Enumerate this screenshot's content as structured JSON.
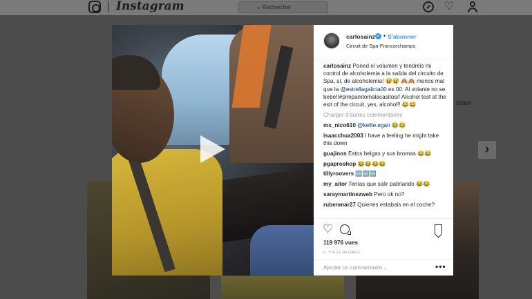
{
  "header": {
    "brand": "Instagram",
    "search_placeholder": "Rechercher",
    "nav_icons": [
      "instagram-logo-icon",
      "compass-icon",
      "heart-icon",
      "person-icon"
    ]
  },
  "background": {
    "partial_text": "team",
    "next_arrow": "›"
  },
  "post": {
    "username": "carlosainz",
    "verified_mark": "✔",
    "separator": "•",
    "follow_label": "S'abonner",
    "location": "Circuit de Spa-Francorchamps",
    "caption_user": "carlosainz",
    "caption_text_1": " Poned el volumen y tendréis mi control de alcoholemia a la salida del circuito de Spa, sí, de alcoholemia! 😅😅 🙈🙈 menos mal que la ",
    "caption_mention": "@estrellagalicia00",
    "caption_text_2": " es 00. Al volante no se bebe!!#pimpamtomalacasitos// Alcohol test at the exit of the circuit, yes, alcohol!! 😂😂",
    "load_more": "Charger d'autres commentaires",
    "comments": [
      {
        "user": "mx_nico610",
        "mention": "@kellie.egan",
        "text": " 😂😂"
      },
      {
        "user": "isaacchua2003",
        "mention": "",
        "text": " I have a feeling he might take this down"
      },
      {
        "user": "guajinos",
        "mention": "",
        "text": " Estos belgas y sus bromas 😂😂"
      },
      {
        "user": "pgaproshop",
        "mention": "",
        "text": " 😂😂😂😂"
      },
      {
        "user": "tillyroovers",
        "mention": "",
        "text": " 🆒🆒🆒"
      },
      {
        "user": "my_aitor",
        "mention": "",
        "text": " Tenías que salir patinando 😂😂"
      },
      {
        "user": "saraymartinezweb",
        "mention": "",
        "text": " Pero ok no?"
      },
      {
        "user": "rubenmar27",
        "mention": "",
        "text": " Quienes estabais en el coche?"
      }
    ],
    "views": "119 976 vues",
    "time": "Il y a 17 heures",
    "add_comment_placeholder": "Ajouter un commentaire…",
    "more_label": "•••"
  }
}
